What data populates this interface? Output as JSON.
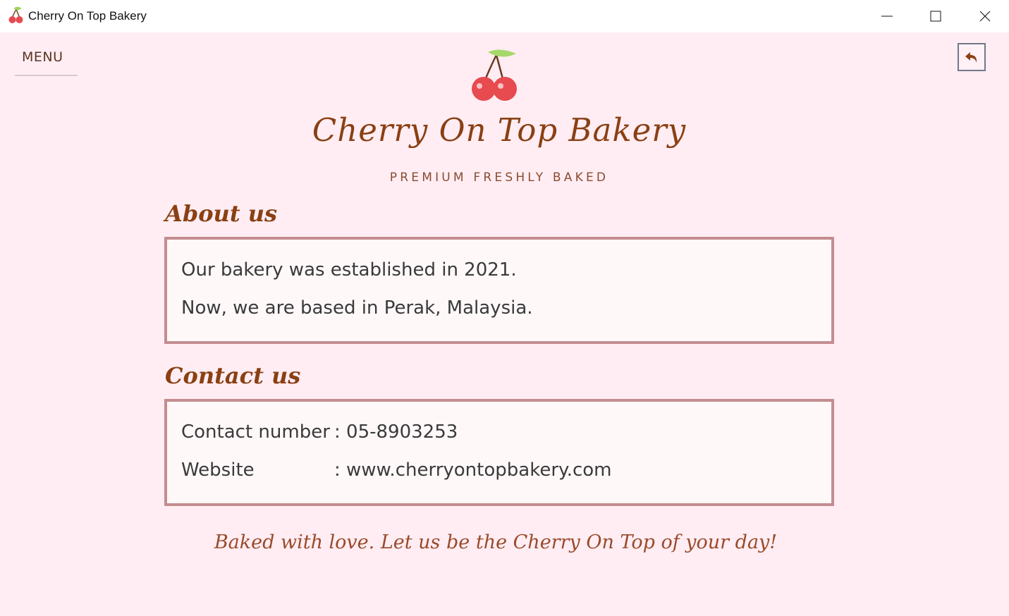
{
  "window": {
    "title": "Cherry On Top Bakery",
    "icon": "cherry-icon",
    "controls": [
      "minimize-icon",
      "maximize-icon",
      "close-icon"
    ]
  },
  "nav": {
    "menu_label": "MENU",
    "back_icon": "back-arrow-icon"
  },
  "brand": {
    "logo_icon": "cherry-logo-icon",
    "title": "Cherry On Top Bakery",
    "tagline": "PREMIUM FRESHLY BAKED"
  },
  "about": {
    "heading": "About us",
    "lines": [
      "Our bakery was established in 2021.",
      "Now, we are based in Perak, Malaysia."
    ]
  },
  "contact": {
    "heading": "Contact us",
    "phone_label": "Contact number",
    "phone_value": ": 05-8903253",
    "website_label": "Website",
    "website_value": ": www.cherryontopbakery.com"
  },
  "footer": {
    "slogan": "Baked with love. Let us be the Cherry On Top of your day!"
  },
  "colors": {
    "background": "#ffedf3",
    "brand_brown": "#8a4013",
    "box_border": "#c38d8f",
    "cherry_red": "#e74a4f",
    "leaf_green": "#a6d86a"
  }
}
